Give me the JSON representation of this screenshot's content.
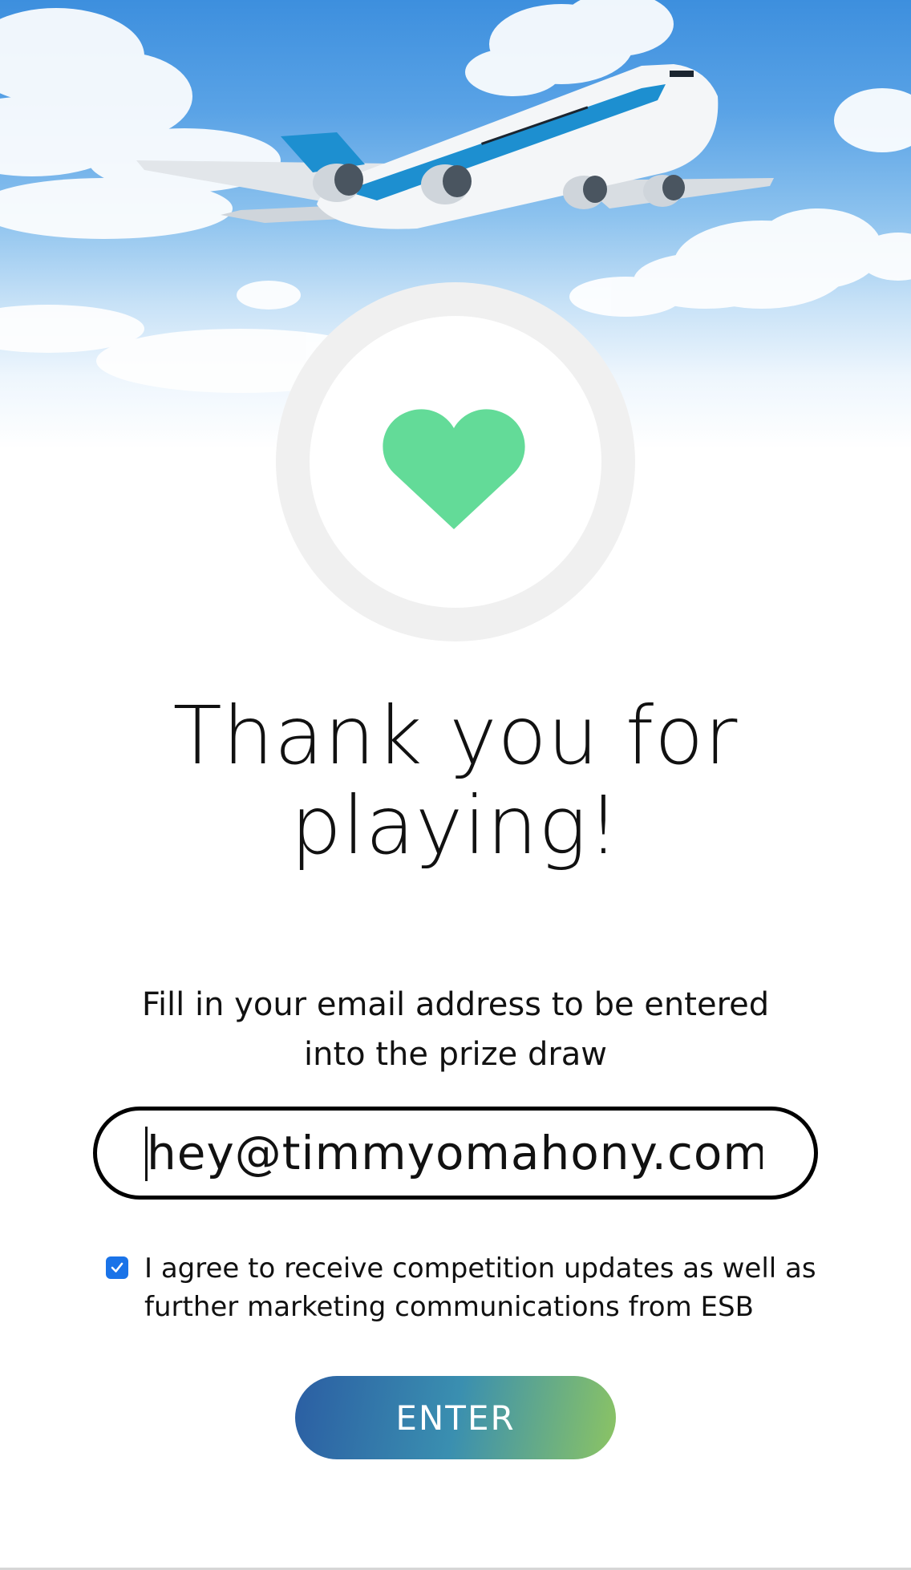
{
  "hero": {
    "image": "airplane-in-sky",
    "icon": "heart-icon",
    "icon_color": "#63db98"
  },
  "title": {
    "line1": "Thank you for",
    "line2": "playing!"
  },
  "form": {
    "instruction_line1": "Fill in your email address to be entered",
    "instruction_line2": "into the prize draw",
    "email_value": "hey@timmyomahony.com",
    "consent_checked": true,
    "consent_line1": "I agree to receive competition updates as well as",
    "consent_line2": "further marketing communications from ESB",
    "submit_label": "ENTER"
  },
  "colors": {
    "accent_gradient_start": "#2b5ea3",
    "accent_gradient_end": "#8cc463",
    "checkbox": "#1a73e8"
  }
}
